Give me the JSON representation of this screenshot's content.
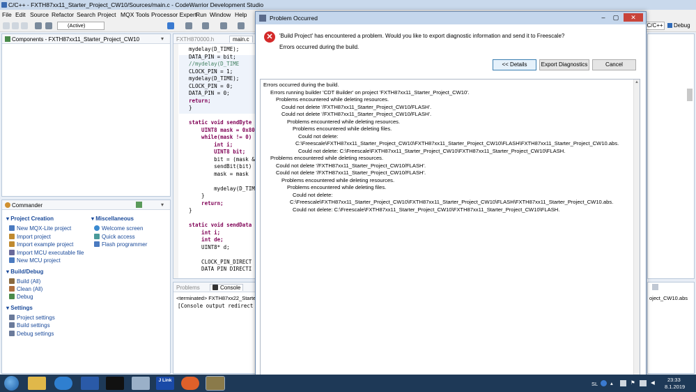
{
  "window": {
    "title": "C/C++ - FXTH87xx11_Starter_Project_CW10/Sources/main.c - CodeWarrior Development Studio"
  },
  "menu": [
    "File",
    "Edit",
    "Source",
    "Refactor",
    "Search",
    "Project",
    "MQX Tools",
    "Processor Expert",
    "Run",
    "Window",
    "Help"
  ],
  "toolbar": {
    "config": "(Active)",
    "perspective_cpp": "C/C++",
    "perspective_debug": "Debug"
  },
  "components": {
    "title": "Components - FXTH87xx11_Starter_Project_CW10"
  },
  "editor": {
    "tabs": [
      "FXTH870000.h",
      "main.c"
    ],
    "lines": [
      "mydelay(D_TIME);",
      "DATA_PIN = bit;",
      "//mydelay(D_TIME",
      "CLOCK_PIN = 1;",
      "mydelay(D_TIME);",
      "CLOCK_PIN = 0;",
      "DATA_PIN = 0;",
      "return;",
      "}",
      "",
      "static void sendByte",
      "    UINT8 mask = 0x80",
      "    while(mask != 0)",
      "        int i;",
      "        UINT8 bit;",
      "        bit = (mask &",
      "        sendBit(bit)",
      "        mask = mask",
      "",
      "        mydelay(D_TIM",
      "    }",
      "    return;",
      "}",
      "",
      "static void sendData",
      "    int i;",
      "    int de;",
      "    UINT8* d;",
      "",
      "    CLOCK_PIN_DIRECT",
      "    DATA PIN DIRECTI"
    ]
  },
  "commander": {
    "title": "Commander",
    "project_creation": {
      "title": "Project Creation",
      "items": [
        "New MQX-Lite project",
        "Import project",
        "Import example project",
        "Import MCU executable file",
        "New MCU project"
      ]
    },
    "miscellaneous": {
      "title": "Miscellaneous",
      "items": [
        "Welcome screen",
        "Quick access",
        "Flash programmer"
      ]
    },
    "build_debug": {
      "title": "Build/Debug",
      "items": [
        "Build  (All)",
        "Clean  (All)",
        "Debug"
      ]
    },
    "settings": {
      "title": "Settings",
      "items": [
        "Project settings",
        "Build settings",
        "Debug settings"
      ]
    }
  },
  "console": {
    "tab_problems": "Problems",
    "tab_console": "Console",
    "terminated": "<terminated> FXTH87xx22_Starte",
    "output": "[Console output redirect",
    "right_text": "oject_CW10.abs"
  },
  "dialog": {
    "title": "Problem Occurred",
    "message": "'Build Project' has encountered a problem. Would you like to export diagnostic information and send it to Freescale?",
    "submessage": "Errors occurred during the build.",
    "buttons": {
      "details": "<< Details",
      "export": "Export Diagnostics",
      "cancel": "Cancel"
    },
    "details_lines": [
      "Errors occurred during the build.",
      "Errors running builder 'CDT Builder' on project 'FXTH87xx11_Starter_Project_CW10'.",
      "Problems encountered while deleting resources.",
      "Could not delete '/FXTH87xx11_Starter_Project_CW10/FLASH'.",
      "Could not delete '/FXTH87xx11_Starter_Project_CW10/FLASH'.",
      "Problems encountered while deleting resources.",
      "Problems encountered while deleting files.",
      "Could not delete:",
      "C:\\Freescale\\FXTH87xx11_Starter_Project_CW10\\FXTH87xx11_Starter_Project_CW10\\FLASH\\FXTH87xx11_Starter_Project_CW10.abs.",
      "Could not delete: C:\\Freescale\\FXTH87xx11_Starter_Project_CW10\\FXTH87xx11_Starter_Project_CW10\\FLASH.",
      "Problems encountered while deleting resources.",
      "Could not delete '/FXTH87xx11_Starter_Project_CW10/FLASH'.",
      "Could not delete '/FXTH87xx11_Starter_Project_CW10/FLASH'.",
      "Problems encountered while deleting resources.",
      "Problems encountered while deleting files.",
      "Could not delete:",
      "C:\\Freescale\\FXTH87xx11_Starter_Project_CW10\\FXTH87xx11_Starter_Project_CW10\\FLASH\\FXTH87xx11_Starter_Project_CW10.abs.",
      "Could not delete: C:\\Freescale\\FXTH87xx11_Starter_Project_CW10\\FXTH87xx11_Starter_Project_CW10\\FLASH."
    ]
  },
  "taskbar": {
    "lang": "SL",
    "time": "23:33",
    "date": "8.1.2019",
    "jlink": "J Link"
  }
}
